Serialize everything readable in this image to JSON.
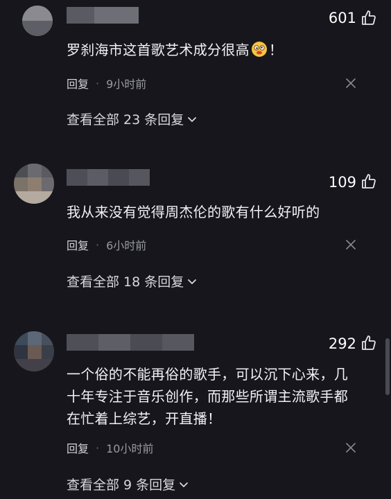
{
  "comments": [
    {
      "likes": "601",
      "text": "罗刹海市这首歌艺术成分很高",
      "text_suffix": "！",
      "reply_label": "回复",
      "separator": "·",
      "time": "9小时前",
      "view_replies": "查看全部 23 条回复"
    },
    {
      "likes": "109",
      "text": "我从来没有觉得周杰伦的歌有什么好听的",
      "reply_label": "回复",
      "separator": "·",
      "time": "6小时前",
      "view_replies": "查看全部 18 条回复"
    },
    {
      "likes": "292",
      "text_lines": [
        "一个俗的不能再俗的歌手，可以沉下心来，几",
        "十年专注于音乐创作，而那些所谓主流歌手都",
        "在忙着上综艺，开直播！"
      ],
      "reply_label": "回复",
      "separator": "·",
      "time": "10小时前",
      "view_replies": "查看全部 9 条回复"
    }
  ],
  "icons": {
    "like": "thumbs-up-icon",
    "dismiss": "close-icon",
    "expand": "chevron-down-icon",
    "emoji": "emoji-icon"
  },
  "colors": {
    "background": "#16161c",
    "text": "#f2f2f6",
    "muted": "#9a9aa3"
  }
}
